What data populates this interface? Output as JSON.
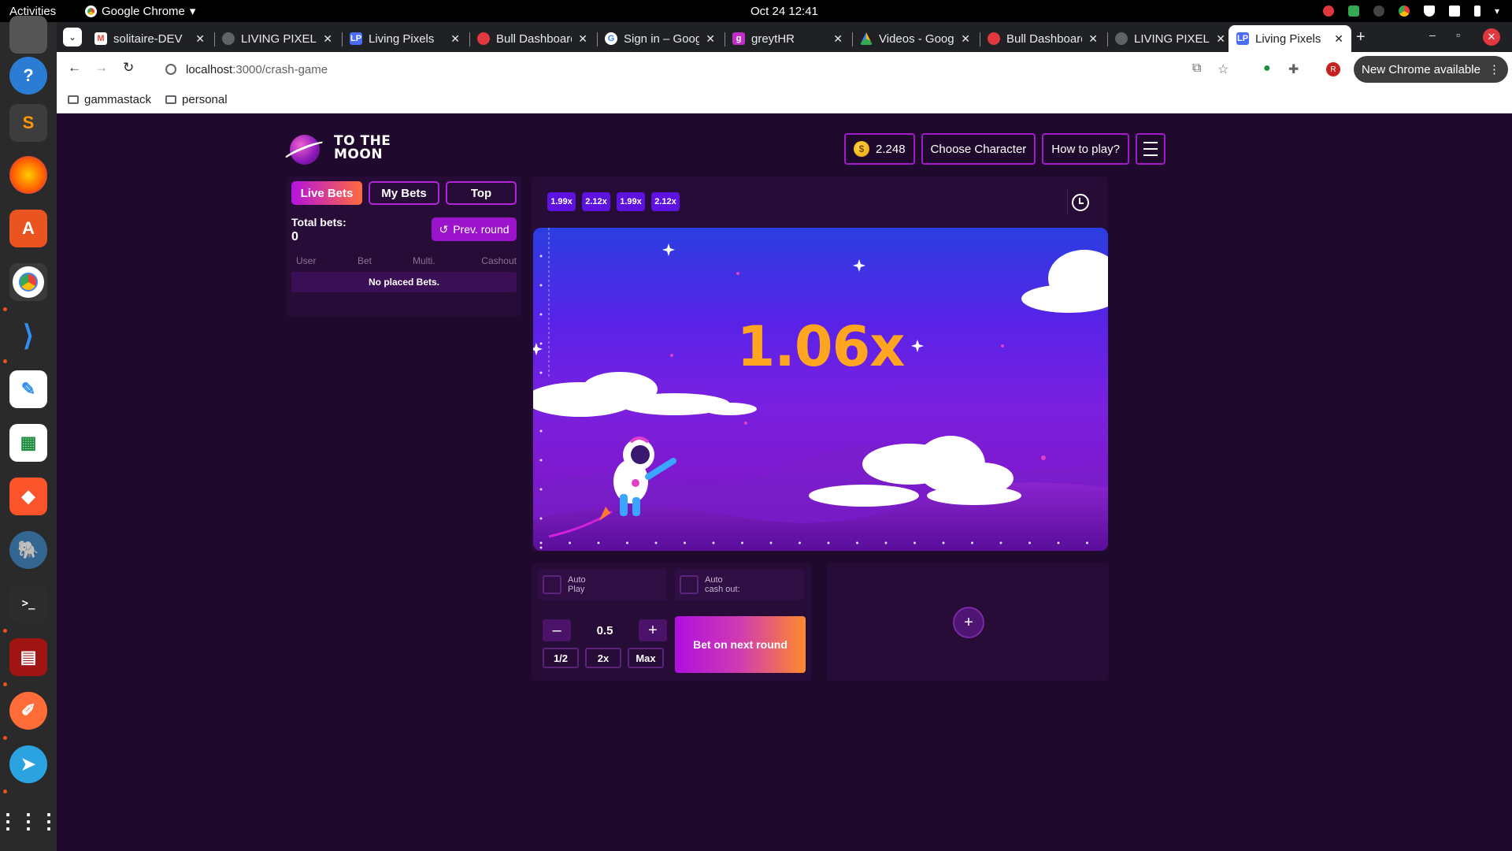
{
  "system": {
    "activities": "Activities",
    "app_name": "Google Chrome",
    "clock": "Oct 24  12:41"
  },
  "browser": {
    "tabs": [
      {
        "title": "solitaire-DEV",
        "favicon": "gmail-icon",
        "fav_color": "#ea4335"
      },
      {
        "title": "LIVING PIXELS",
        "favicon": "globe-icon",
        "fav_color": "#8a8a8a"
      },
      {
        "title": "Living Pixels",
        "favicon": "lp-icon",
        "fav_color": "#4a6cf7"
      },
      {
        "title": "Bull Dashboard",
        "favicon": "bull-icon",
        "fav_color": "#e0383e"
      },
      {
        "title": "Sign in – Google",
        "favicon": "google-icon",
        "fav_color": "#4285f4"
      },
      {
        "title": "greytHR",
        "favicon": "greythr-icon",
        "fav_color": "#c02ec8"
      },
      {
        "title": "Videos - Google",
        "favicon": "drive-icon",
        "fav_color": "#fbbc05"
      },
      {
        "title": "Bull Dashboard",
        "favicon": "bull-icon",
        "fav_color": "#e0383e"
      },
      {
        "title": "LIVING PIXELS",
        "favicon": "globe-icon",
        "fav_color": "#8a8a8a"
      },
      {
        "title": "Living Pixels",
        "favicon": "lp-icon",
        "fav_color": "#4a6cf7",
        "active": true
      }
    ],
    "url_host": "localhost",
    "url_path": ":3000/crash-game",
    "update_label": "New Chrome available",
    "profile_initial": "R",
    "bookmarks": [
      "gammastack",
      "personal"
    ]
  },
  "game": {
    "logo_line1": "TO THE",
    "logo_line2": "MOON",
    "balance": "2.248",
    "choose_character": "Choose Character",
    "how_to_play": "How to play?",
    "panel_tabs": [
      "Live Bets",
      "My Bets",
      "Top"
    ],
    "active_tab": "Live Bets",
    "total_bets_label": "Total bets:",
    "total_bets_value": "0",
    "prev_round": "Prev. round",
    "columns": [
      "User",
      "Bet",
      "Multi.",
      "Cashout"
    ],
    "empty_message": "No placed Bets.",
    "recent_multipliers": [
      "1.99x",
      "2.12x",
      "1.99x",
      "2.12x"
    ],
    "current_multiplier": "1.06x",
    "auto_play_label": [
      "Auto",
      "Play"
    ],
    "auto_cashout_label": [
      "Auto",
      "cash out:"
    ],
    "bet_amount": "0.5",
    "quick_bets": [
      "1/2",
      "2x",
      "Max"
    ],
    "bet_button": "Bet on next round",
    "colors": {
      "accent": "#b025d8",
      "multiplier": "#ffa51f",
      "chip": "#5e12e0"
    }
  }
}
